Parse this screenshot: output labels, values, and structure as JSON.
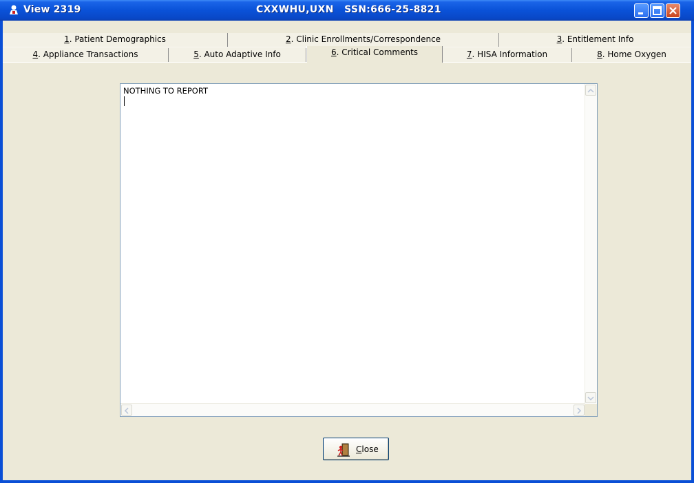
{
  "window": {
    "title": "View 2319",
    "patient_header": "CXXWHU,UXN   SSN:666-25-8821"
  },
  "tabs": {
    "row1": [
      {
        "num": "1",
        "label": ". Patient Demographics"
      },
      {
        "num": "2",
        "label": ". Clinic Enrollments/Correspondence"
      },
      {
        "num": "3",
        "label": ". Entitlement Info"
      }
    ],
    "row2": [
      {
        "num": "4",
        "label": ". Appliance Transactions"
      },
      {
        "num": "5",
        "label": ". Auto Adaptive Info"
      },
      {
        "num": "6",
        "label": ". Critical Comments"
      },
      {
        "num": "7",
        "label": ". HISA Information"
      },
      {
        "num": "8",
        "label": ". Home Oxygen"
      }
    ],
    "active": "6. Critical Comments"
  },
  "comments": {
    "text": "NOTHING TO REPORT"
  },
  "buttons": {
    "close": {
      "mnemonic": "C",
      "rest": "lose"
    }
  },
  "colors": {
    "titlebar": "#0a52d8",
    "client_bg": "#ece9d8"
  }
}
